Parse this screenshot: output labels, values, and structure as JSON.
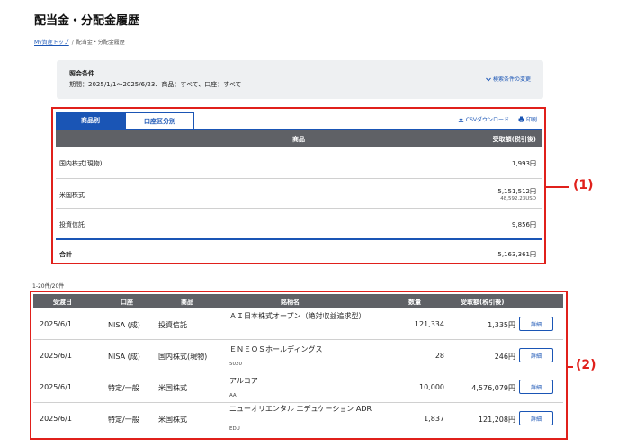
{
  "page": {
    "title": "配当金・分配金履歴",
    "breadcrumb": {
      "home": "My資産トップ",
      "separator": "/",
      "current": "配当金・分配金履歴"
    }
  },
  "conditions": {
    "label": "照会条件",
    "text": "期間：2025/1/1〜2025/6/23、商品：すべて、口座：すべて",
    "change_label": "検索条件の変更"
  },
  "annotations": {
    "label1": "(1)",
    "label2": "(2)"
  },
  "summary": {
    "tabs": [
      {
        "label": "商品別"
      },
      {
        "label": "口座区分別"
      }
    ],
    "csv_label": "CSVダウンロード",
    "print_label": "印刷",
    "header_product": "商品",
    "header_amount": "受取額(税引後)",
    "rows": [
      {
        "name": "国内株式(現物)",
        "amount": "1,993円"
      },
      {
        "name": "米国株式",
        "amount": "5,151,512円",
        "sub": "48,592.23USD"
      },
      {
        "name": "投資信託",
        "amount": "9,856円"
      }
    ],
    "total": {
      "name": "合計",
      "amount": "5,163,361円"
    }
  },
  "list": {
    "count": "1-20件/20件",
    "headers": {
      "date": "受渡日",
      "account": "口座",
      "product": "商品",
      "name": "銘柄名",
      "quantity": "数量",
      "amount": "受取額(税引後)"
    },
    "detail_label": "詳細",
    "rows": [
      {
        "date": "2025/6/1",
        "account": "NISA (成)",
        "product": "投資信託",
        "name": "ＡＩ日本株式オープン（絶対収益追求型）",
        "code": "",
        "quantity": "121,334",
        "amount": "1,335円"
      },
      {
        "date": "2025/6/1",
        "account": "NISA (成)",
        "product": "国内株式(現物)",
        "name": "ＥＮＥＯＳホールディングス",
        "code": "5020",
        "quantity": "28",
        "amount": "246円"
      },
      {
        "date": "2025/6/1",
        "account": "特定/一般",
        "product": "米国株式",
        "name": "アルコア",
        "code": "AA",
        "quantity": "10,000",
        "amount": "4,576,079円"
      },
      {
        "date": "2025/6/1",
        "account": "特定/一般",
        "product": "米国株式",
        "name": "ニューオリエンタル エデュケーション ADR",
        "code": "EDU",
        "quantity": "1,837",
        "amount": "121,208円"
      }
    ]
  },
  "colors": {
    "accent": "#1a55b5",
    "header_bg": "#5f6166",
    "annotation_red": "#e0201b",
    "panel_bg": "#eef0f2"
  },
  "icons": {
    "csv": "download-icon",
    "print": "printer-icon",
    "change": "chevron-down-icon"
  }
}
